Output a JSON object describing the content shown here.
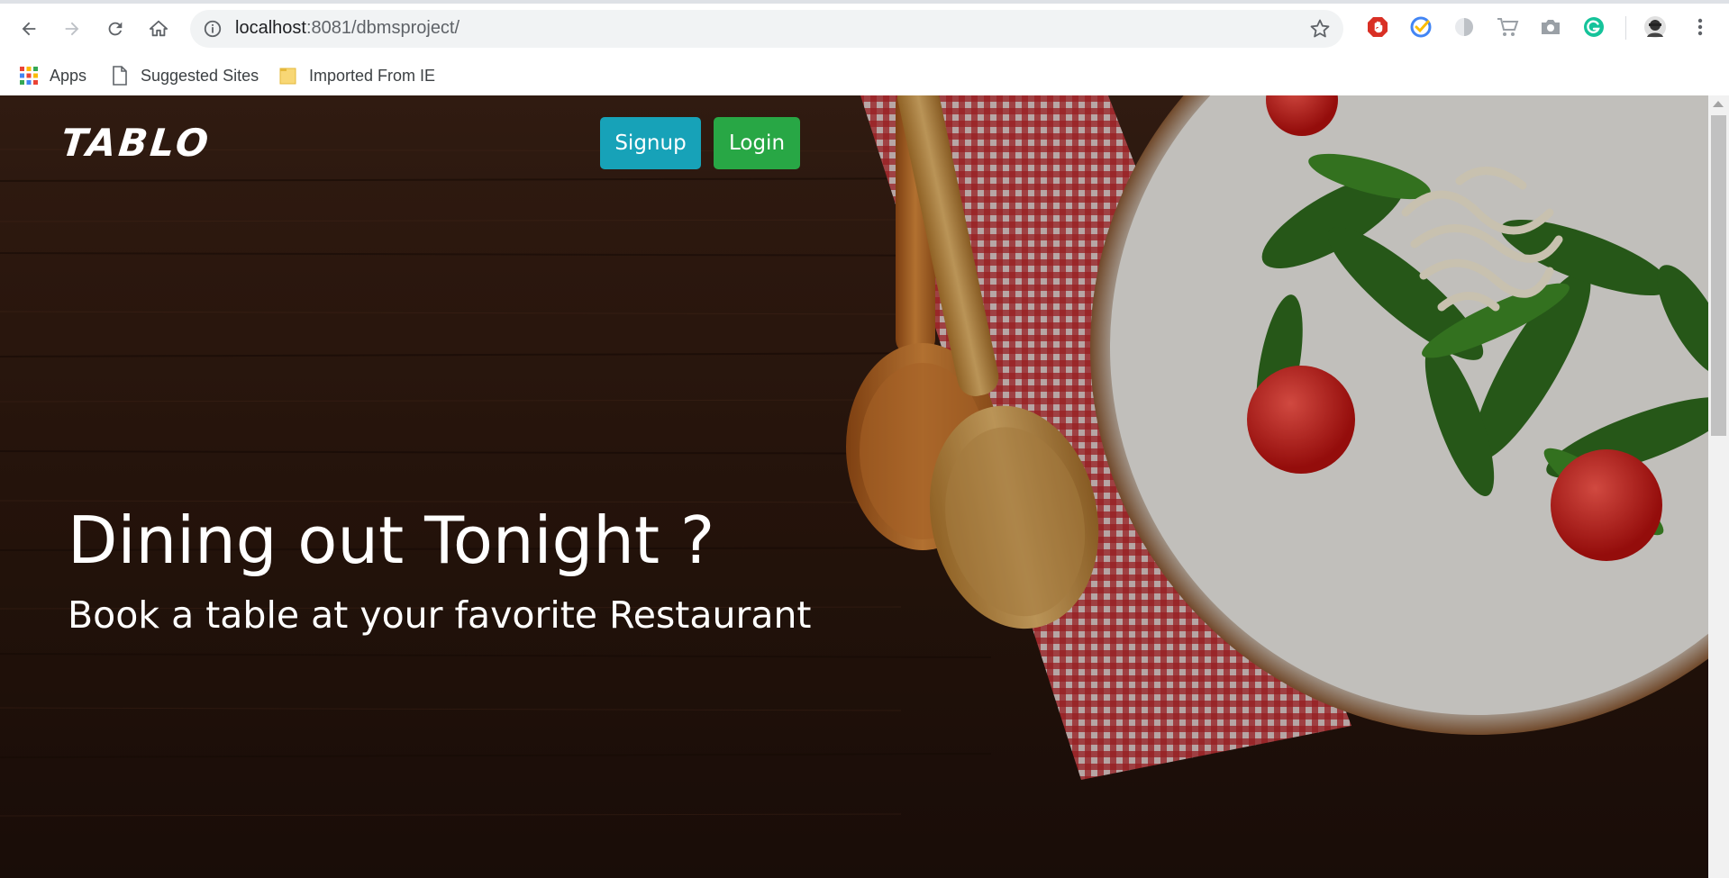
{
  "browser": {
    "url_host": "localhost",
    "url_port": ":8081",
    "url_path": "/dbmsproject/",
    "icons": [
      "back-icon",
      "forward-icon",
      "reload-icon",
      "home-icon",
      "info-icon",
      "star-icon",
      "adblock-icon",
      "tasks-icon",
      "extension-icon",
      "cart-icon",
      "camera-icon",
      "grammarly-icon",
      "profile-avatar",
      "menu-icon"
    ]
  },
  "bookmarks": [
    {
      "label": "Apps",
      "icon": "apps-grid-icon"
    },
    {
      "label": "Suggested Sites",
      "icon": "page-icon"
    },
    {
      "label": "Imported From IE",
      "icon": "folder-icon"
    }
  ],
  "page": {
    "brand": "TABLO",
    "signup_label": "Signup",
    "login_label": "Login",
    "headline": "Dining out Tonight ?",
    "subline": "Book a table at your favorite Restaurant"
  },
  "colors": {
    "signup": "#17a2b8",
    "login": "#28a745",
    "wood": "#3a1f12"
  }
}
